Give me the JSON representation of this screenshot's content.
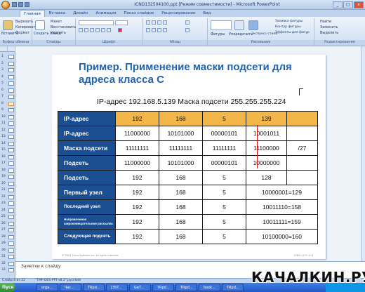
{
  "window": {
    "title": "ICND132504100.ppt [Режим совместимости] - Microsoft PowerPoint",
    "controls": [
      "_",
      "□",
      "x"
    ]
  },
  "ribbon": {
    "tabs": [
      "Главная",
      "Вставка",
      "Дизайн",
      "Анимация",
      "Показ слайдов",
      "Рецензирование",
      "Вид"
    ],
    "clipboard": {
      "paste": "Вставить",
      "cut": "Вырезать",
      "copy": "Копировать",
      "format_painter": "Формат",
      "label": "Буфер обмена"
    },
    "slides": {
      "create": "Создать слайд",
      "layout": "Макет",
      "reset": "Восстановить",
      "delete": "Удалить",
      "label": "Слайды"
    },
    "font": {
      "label": "Шрифт"
    },
    "paragraph": {
      "label": "Абзац"
    },
    "drawing": {
      "shapes": "Фигуры",
      "arrange": "Упорядочить",
      "quick_styles": "Экспресс-стили",
      "fill": "Заливка фигуры",
      "outline": "Контур фигуры",
      "effects": "Эффекты для фигур",
      "label": "Рисование"
    },
    "editing": {
      "find": "Найти",
      "replace": "Заменить",
      "select": "Выделить",
      "label": "Редактирование"
    }
  },
  "thumbnails": [
    "1",
    "2",
    "3",
    "4",
    "5",
    "6",
    "7",
    "8",
    "9",
    "10",
    "11",
    "12",
    "13",
    "14",
    "15",
    "16",
    "17",
    "18",
    "19",
    "20",
    "21",
    "22",
    "23",
    "24",
    "25",
    "26",
    "27",
    "28",
    "29",
    "30",
    "31",
    "32",
    "33",
    "34"
  ],
  "slide": {
    "title": "Пример. Применение маски подсети для адреса класса С",
    "subtitle": "IP-адрес 192.168.5.139      Маска подсети 255.255.255.224",
    "footer_left": "© 2007 Cisco Systems Inc. All rights reserved.",
    "footer_right": "ICND v1.0—4-8",
    "table": [
      {
        "label": "IP-адрес",
        "cells": [
          "192",
          "168",
          "5",
          "139",
          ""
        ]
      },
      {
        "label": "IP-адрес",
        "cells": [
          "11000000",
          "10101000",
          "00000101",
          "10001011",
          ""
        ]
      },
      {
        "label": "Маска подсети",
        "cells": [
          "11111111",
          "11111111",
          "11111111",
          "11100000",
          "/27"
        ]
      },
      {
        "label": "Подсеть",
        "cells": [
          "11000000",
          "10101000",
          "00000101",
          "10000000",
          ""
        ]
      },
      {
        "label": "Подсеть",
        "cells": [
          "192",
          "168",
          "5",
          "128",
          ""
        ]
      },
      {
        "label": "Первый узел",
        "cells": [
          "192",
          "168",
          "5",
          "10000001=129"
        ]
      },
      {
        "label": "Последний узел",
        "cells": [
          "192",
          "168",
          "5",
          "10011110=158"
        ]
      },
      {
        "label": "Направленная широковещательная рассылка",
        "cells": [
          "192",
          "168",
          "5",
          "10011111=159"
        ]
      },
      {
        "label": "Следующая подсеть",
        "cells": [
          "192",
          "168",
          "5",
          "10100000=160"
        ]
      }
    ]
  },
  "notes": {
    "placeholder": "Заметки к слайду"
  },
  "status": {
    "slide": "Слайд 8 из 22",
    "theme": "\"TMP-DES-PPT-v8.2\"",
    "lang": "русский"
  },
  "taskbar": {
    "start": "Пуск",
    "items": [
      "orga...",
      "Час...",
      "TRpd...",
      "[35T...",
      "GeT...",
      "TRpd...",
      "TRpd...",
      "book...",
      "TRpd..."
    ]
  },
  "watermark": "КАЧАЛКИН.РУ"
}
